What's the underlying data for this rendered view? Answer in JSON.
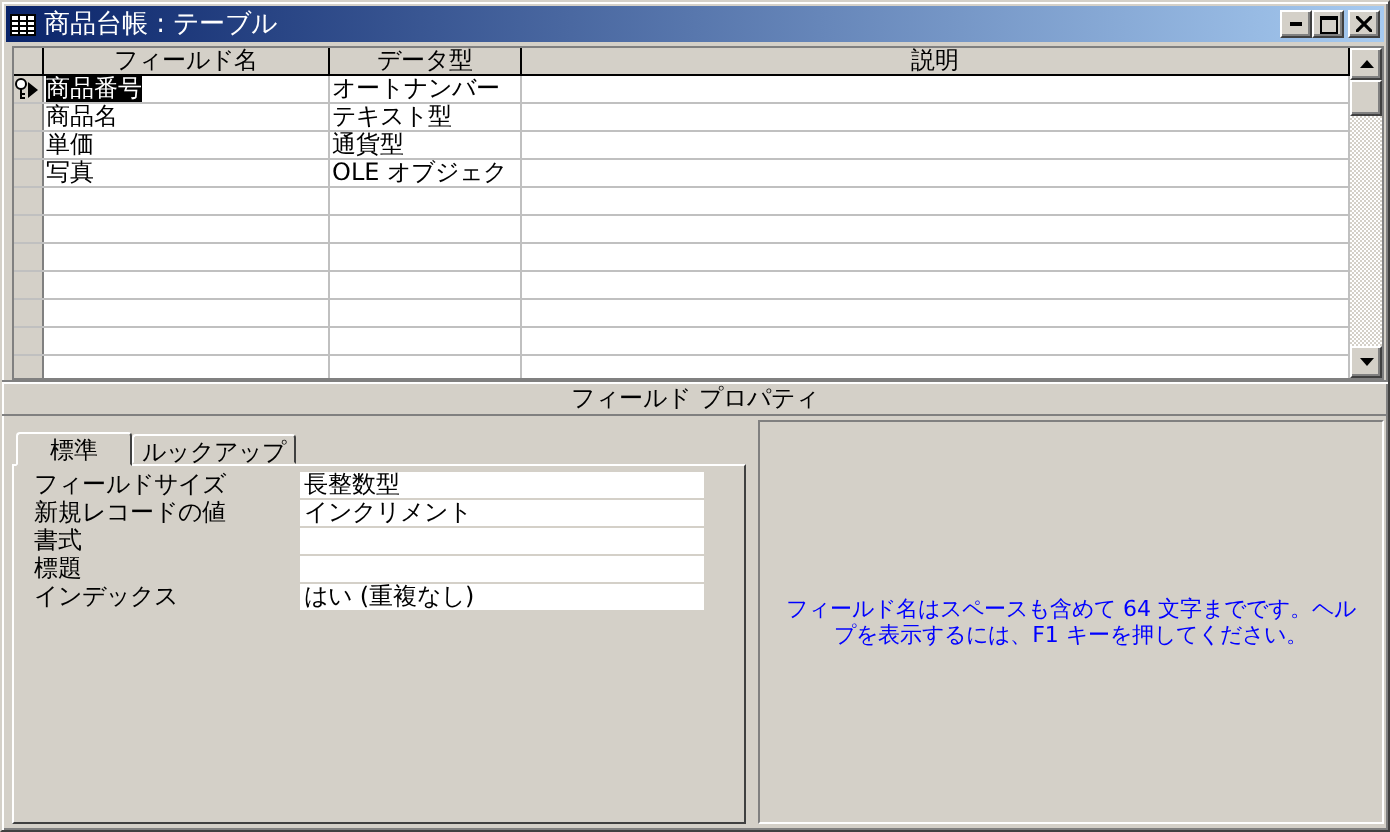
{
  "window": {
    "title": "商品台帳 : テーブル"
  },
  "grid": {
    "columns": [
      "フィールド名",
      "データ型",
      "説明"
    ],
    "rows": [
      {
        "field_name": "商品番号",
        "data_type": "オートナンバー",
        "selected": true,
        "primary_key": true
      },
      {
        "field_name": "商品名",
        "data_type": "テキスト型",
        "selected": false,
        "primary_key": false
      },
      {
        "field_name": "単価",
        "data_type": "通貨型",
        "selected": false,
        "primary_key": false
      },
      {
        "field_name": "写真",
        "data_type": "OLE オブジェク",
        "selected": false,
        "primary_key": false
      }
    ]
  },
  "properties": {
    "heading": "フィールド プロパティ",
    "tabs": [
      {
        "label": "標準",
        "selected": true
      },
      {
        "label": "ルックアップ",
        "selected": false
      }
    ],
    "rows": [
      {
        "label": "フィールドサイズ",
        "value": "長整数型"
      },
      {
        "label": "新規レコードの値",
        "value": "インクリメント"
      },
      {
        "label": "書式",
        "value": ""
      },
      {
        "label": "標題",
        "value": ""
      },
      {
        "label": "インデックス",
        "value": "はい (重複なし)"
      }
    ],
    "help": "フィールド名はスペースも含めて 64 文字までです。ヘルプを表示するには、F1 キーを押してください。"
  }
}
